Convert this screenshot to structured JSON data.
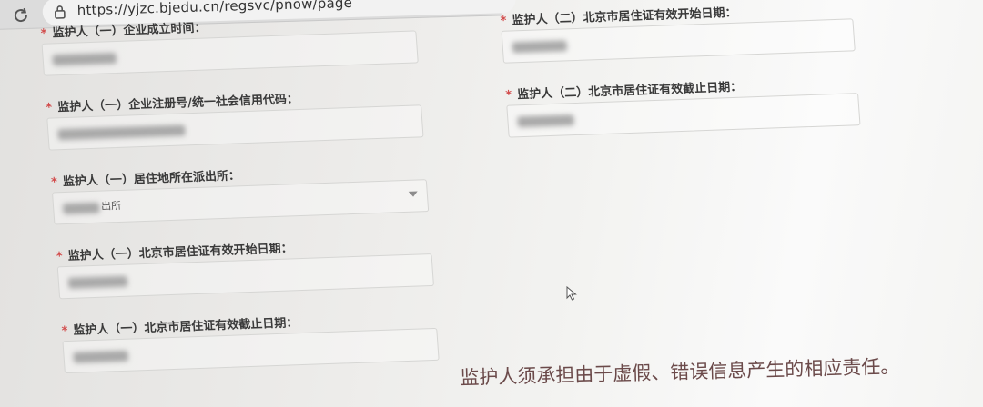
{
  "browser": {
    "url": "https://yjzc.bjedu.cn/regsvc/pnow/page"
  },
  "form": {
    "left_fields": [
      {
        "label": "监护人（一）企业成立时间：",
        "value_suffix": ""
      },
      {
        "label": "监护人（一）企业注册号/统一社会信用代码：",
        "value_suffix": ""
      },
      {
        "label": "监护人（一）居住地所在派出所：",
        "value_suffix": "出所"
      },
      {
        "label": "监护人（一）北京市居住证有效开始日期：",
        "value_suffix": ""
      },
      {
        "label": "监护人（一）北京市居住证有效截止日期：",
        "value_suffix": ""
      }
    ],
    "right_fields": [
      {
        "label": "监护人（二）北京市居住证有效开始日期：",
        "value_suffix": ""
      },
      {
        "label": "监护人（二）北京市居住证有效截止日期：",
        "value_suffix": ""
      }
    ],
    "required_mark": "*"
  },
  "notice": {
    "text": "监护人须承担由于虚假、错误信息产生的相应责任。"
  },
  "colors": {
    "required": "#d24b4b",
    "label": "#3a3a3a",
    "notice": "#6b4a4a"
  }
}
